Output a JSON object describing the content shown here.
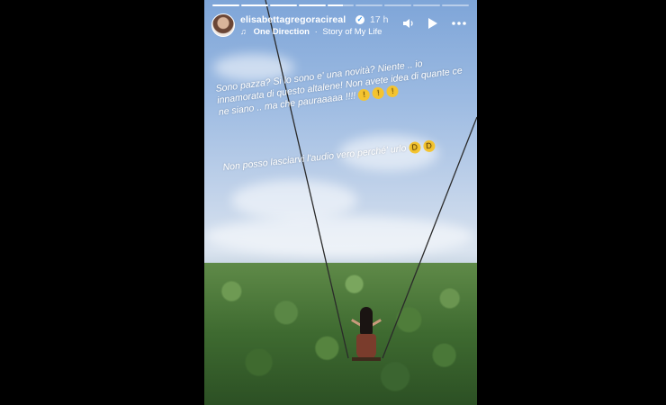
{
  "story": {
    "progress": [
      1,
      1,
      1,
      1,
      0.6,
      0,
      0,
      0,
      0
    ],
    "username": "elisabettagregoracireal",
    "verified_mark": "✓",
    "time_ago": "17 h",
    "music": {
      "icon": "music-bars-icon",
      "artist": "One Direction",
      "separator": "·",
      "song": "Story of My Life"
    },
    "controls": {
      "mute_icon": "speaker-icon",
      "play_icon": "play-icon",
      "more_icon": "more-icon"
    },
    "caption_1": "Sono pazza? Si lo sono e' una novità? Niente .. io innamorata di questo altalene! Non avete idea di quante ce ne siano .. ma che pauraaaaa !!!!",
    "caption_2": "Non posso lasciarvi l'audio vero perché' urlo",
    "colors": {
      "sky_top": "#7ea5d8",
      "forest": "#3e6a30",
      "text": "#ffffff"
    }
  }
}
